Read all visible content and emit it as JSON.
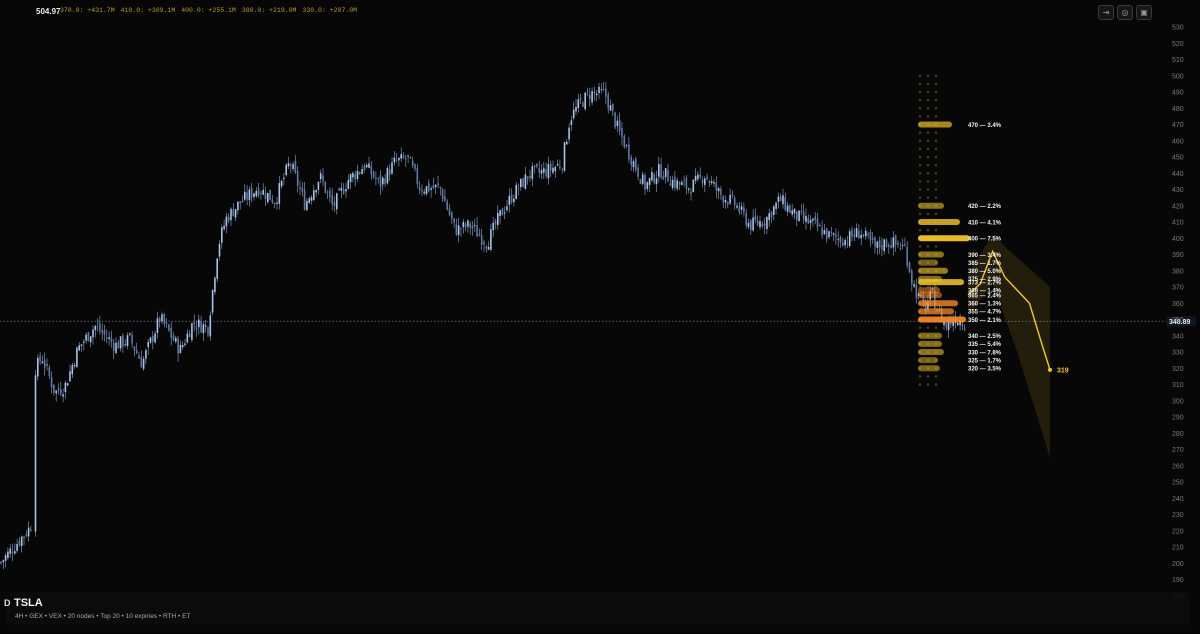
{
  "header": {
    "price_readout": "504.97",
    "gex_summary": [
      "370.0: +431.7M",
      "410.0: +309.1M",
      "400.0: +255.1M",
      "380.0: +219.0M",
      "330.0: +207.0M"
    ],
    "tools": [
      {
        "name": "share-icon",
        "glyph": "⇥"
      },
      {
        "name": "target-icon",
        "glyph": "◎"
      },
      {
        "name": "camera-icon",
        "glyph": "▣"
      }
    ]
  },
  "info": {
    "ticker": "TSLA",
    "subtitle": "4H • GEX • VEX • 20 nodes • Top 20 • 10 expiries • RTH • ET",
    "corner_label": "D"
  },
  "chart_data": {
    "type": "candlestick",
    "y_range": [
      170,
      535
    ],
    "y_ticks": [
      530,
      520,
      510,
      500,
      490,
      480,
      470,
      460,
      450,
      440,
      430,
      420,
      410,
      400,
      390,
      380,
      370,
      360,
      350,
      340,
      330,
      320,
      310,
      300,
      290,
      280,
      270,
      260,
      250,
      240,
      230,
      220,
      210,
      200,
      190,
      180
    ],
    "last_price": 348.89,
    "last_price_label": "348.89",
    "price_path": [
      [
        0,
        200
      ],
      [
        30,
        222
      ],
      [
        33,
        226
      ],
      [
        34,
        318
      ],
      [
        42,
        327
      ],
      [
        55,
        305
      ],
      [
        65,
        309
      ],
      [
        78,
        332
      ],
      [
        95,
        346
      ],
      [
        115,
        334
      ],
      [
        130,
        338
      ],
      [
        142,
        323
      ],
      [
        160,
        351
      ],
      [
        180,
        331
      ],
      [
        193,
        348
      ],
      [
        208,
        345
      ],
      [
        218,
        395
      ],
      [
        226,
        412
      ],
      [
        240,
        422
      ],
      [
        258,
        431
      ],
      [
        275,
        423
      ],
      [
        290,
        447
      ],
      [
        305,
        421
      ],
      [
        320,
        438
      ],
      [
        333,
        419
      ],
      [
        348,
        436
      ],
      [
        365,
        445
      ],
      [
        380,
        433
      ],
      [
        395,
        447
      ],
      [
        408,
        449
      ],
      [
        420,
        431
      ],
      [
        440,
        431
      ],
      [
        455,
        405
      ],
      [
        470,
        408
      ],
      [
        487,
        397
      ],
      [
        500,
        414
      ],
      [
        512,
        426
      ],
      [
        530,
        440
      ],
      [
        545,
        441
      ],
      [
        562,
        446
      ],
      [
        570,
        474
      ],
      [
        580,
        483
      ],
      [
        590,
        489
      ],
      [
        605,
        489
      ],
      [
        618,
        467
      ],
      [
        630,
        451
      ],
      [
        645,
        432
      ],
      [
        660,
        442
      ],
      [
        675,
        434
      ],
      [
        690,
        431
      ],
      [
        705,
        439
      ],
      [
        720,
        427
      ],
      [
        735,
        421
      ],
      [
        750,
        408
      ],
      [
        765,
        411
      ],
      [
        780,
        424
      ],
      [
        795,
        414
      ],
      [
        812,
        409
      ],
      [
        830,
        401
      ],
      [
        845,
        399
      ],
      [
        860,
        404
      ],
      [
        875,
        394
      ],
      [
        888,
        398
      ],
      [
        905,
        394
      ],
      [
        912,
        374
      ],
      [
        918,
        364
      ],
      [
        925,
        357
      ],
      [
        932,
        366
      ],
      [
        938,
        355
      ],
      [
        946,
        346
      ],
      [
        955,
        351
      ],
      [
        965,
        348
      ]
    ],
    "gex_levels": [
      {
        "strike": 470,
        "label": "470 — 3.4%",
        "strength": 0.55
      },
      {
        "strike": 420,
        "label": "420 — 2.2%",
        "strength": 0.35
      },
      {
        "strike": 410,
        "label": "410 — 4.1%",
        "strength": 0.75
      },
      {
        "strike": 400,
        "label": "400 — 7.5%",
        "strength": 1.0
      },
      {
        "strike": 390,
        "label": "390 — 3.4%",
        "strength": 0.35
      },
      {
        "strike": 385,
        "label": "385 — 1.7%",
        "strength": 0.2
      },
      {
        "strike": 380,
        "label": "380 — 5.0%",
        "strength": 0.45
      },
      {
        "strike": 375,
        "label": "375 — 2.9%",
        "strength": 0.3
      },
      {
        "strike": 373,
        "label": "373 — 2.7%",
        "strength": 0.85
      },
      {
        "strike": 368,
        "label": "368 — 1.4%",
        "strength": 0.25
      },
      {
        "strike": 365,
        "label": "365 — 2.4%",
        "strength": 0.3
      },
      {
        "strike": 360,
        "label": "360 — 1.3%",
        "strength": 0.7
      },
      {
        "strike": 355,
        "label": "355 — 4.7%",
        "strength": 0.6
      },
      {
        "strike": 350,
        "label": "350 — 2.1%",
        "strength": 0.9
      },
      {
        "strike": 340,
        "label": "340 — 2.5%",
        "strength": 0.3
      },
      {
        "strike": 335,
        "label": "335 — 5.4%",
        "strength": 0.3
      },
      {
        "strike": 330,
        "label": "330 — 7.8%",
        "strength": 0.35
      },
      {
        "strike": 325,
        "label": "325 — 1.7%",
        "strength": 0.2
      },
      {
        "strike": 320,
        "label": "320 — 3.5%",
        "strength": 0.25
      }
    ],
    "projection": {
      "end_label": "319",
      "end_value": 319,
      "path": [
        [
          0,
          365
        ],
        [
          0.15,
          372
        ],
        [
          0.3,
          392
        ],
        [
          0.45,
          376
        ],
        [
          0.6,
          368
        ],
        [
          0.75,
          360
        ],
        [
          0.9,
          335
        ],
        [
          1.0,
          319
        ]
      ],
      "band_upper": [
        [
          0,
          378
        ],
        [
          0.3,
          402
        ],
        [
          0.6,
          388
        ],
        [
          1.0,
          370
        ]
      ],
      "band_lower": [
        [
          0,
          352
        ],
        [
          0.3,
          372
        ],
        [
          0.6,
          330
        ],
        [
          1.0,
          265
        ]
      ]
    },
    "colors": {
      "background": "#070707",
      "candle": "#8ea9cf",
      "gex": "#f2c62b",
      "gex_hot": "#ff8f2a",
      "grid_text": "#7a7a7a",
      "last_price": "#5b6b88"
    }
  }
}
